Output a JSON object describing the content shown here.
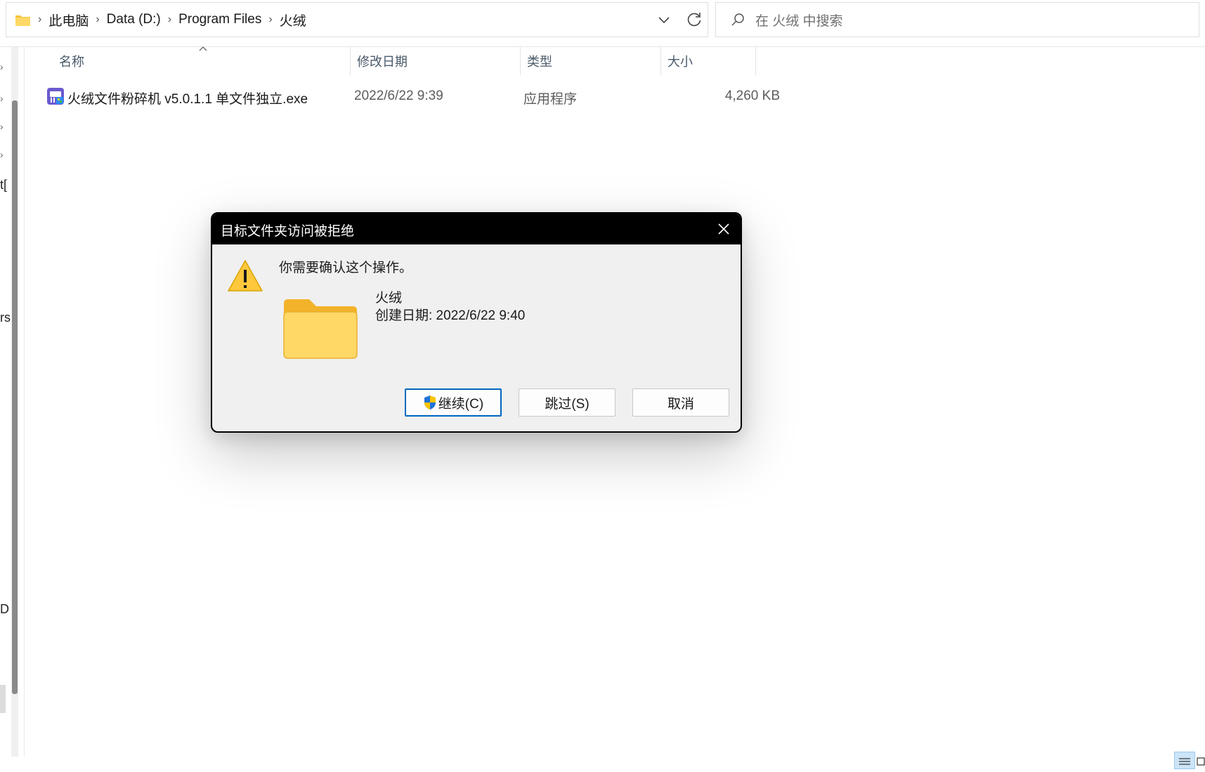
{
  "address_bar": {
    "breadcrumbs": [
      "此电脑",
      "Data (D:)",
      "Program Files",
      "火绒"
    ]
  },
  "search": {
    "placeholder": "在 火绒 中搜索"
  },
  "nav_fragments": [
    "t[",
    "rs",
    "D"
  ],
  "columns": [
    "名称",
    "修改日期",
    "类型",
    "大小"
  ],
  "files": [
    {
      "name": "火绒文件粉碎机 v5.0.1.1 单文件独立.exe",
      "modified": "2022/6/22 9:39",
      "type": "应用程序",
      "size": "4,260 KB"
    }
  ],
  "dialog": {
    "title": "目标文件夹访问被拒绝",
    "message": "你需要确认这个操作。",
    "folder_name": "火绒",
    "folder_created": "创建日期: 2022/6/22 9:40",
    "buttons": {
      "continue": "继续(C)",
      "skip": "跳过(S)",
      "cancel": "取消"
    }
  },
  "colors": {
    "accent": "#0067c0",
    "titlebar": "#000000",
    "dialog_bg": "#f0f0f0",
    "folder": "#f8c93f"
  }
}
